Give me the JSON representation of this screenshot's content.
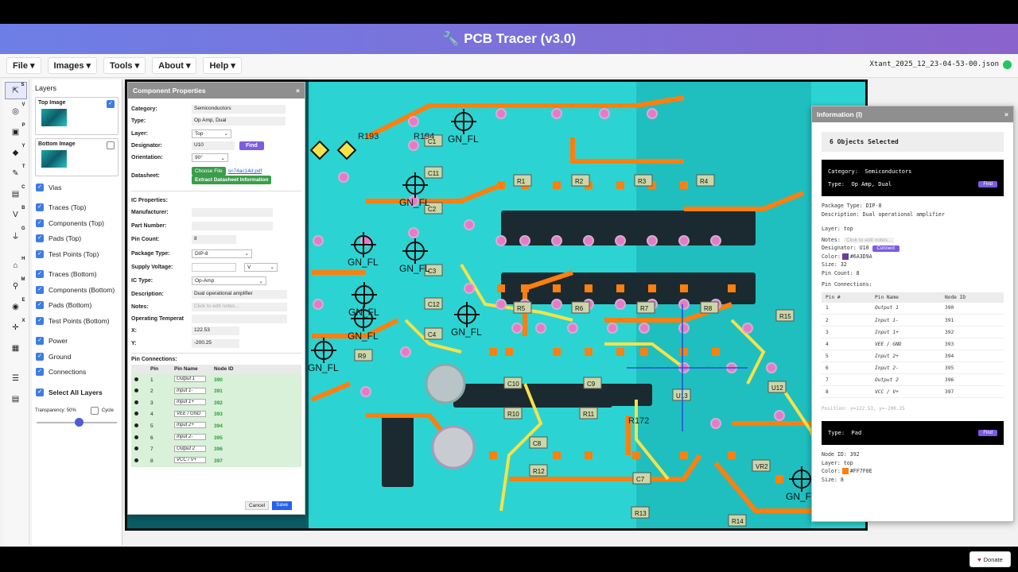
{
  "app": {
    "title": "PCB Tracer (v3.0)",
    "filename": "Xtant_2025_12_23-04-53-00.json",
    "donate": "Donate"
  },
  "menus": [
    "File ▾",
    "Images ▾",
    "Tools ▾",
    "About ▾",
    "Help ▾"
  ],
  "tools": [
    {
      "g": "⇱",
      "k": "S"
    },
    {
      "g": "◎",
      "k": "V",
      "n": "25"
    },
    {
      "g": "▣",
      "k": "P",
      "n": "30"
    },
    {
      "g": "◆",
      "k": "Y",
      "n": "25"
    },
    {
      "g": "✎",
      "k": "T",
      "n": "30"
    },
    {
      "g": "▤",
      "k": "C",
      "n": "1"
    },
    {
      "g": "V",
      "k": "B",
      "n": "25"
    },
    {
      "g": "⏚",
      "k": "G",
      "n": "25"
    },
    {
      "g": "⌂",
      "k": "H"
    },
    {
      "g": "⚲",
      "k": "M"
    },
    {
      "g": "◉",
      "k": "E"
    },
    {
      "g": "✛",
      "k": "X"
    },
    {
      "g": "▦",
      "k": ""
    },
    {
      "g": "☰",
      "k": ""
    },
    {
      "g": "▤",
      "k": ""
    }
  ],
  "layers": {
    "title": "Layers",
    "top_image": "Top Image",
    "bottom_image": "Bottom Image",
    "group1": [
      "Vias"
    ],
    "group2": [
      "Traces (Top)",
      "Components (Top)",
      "Pads (Top)",
      "Test Points (Top)"
    ],
    "group3": [
      "Traces (Bottom)",
      "Components (Bottom)",
      "Pads (Bottom)",
      "Test Points (Bottom)"
    ],
    "group4": [
      "Power",
      "Ground",
      "Connections"
    ],
    "select_all": "Select All Layers",
    "transparency": "Transparency: 50%",
    "cycle": "Cycle",
    "transparency_value": 0.5
  },
  "comp": {
    "title": "Component Properties",
    "category_l": "Category:",
    "category": "Semiconductors",
    "type_l": "Type:",
    "type": "Op Amp, Dual",
    "layer_l": "Layer:",
    "layer": "Top",
    "designator_l": "Designator:",
    "designator": "U10",
    "find": "Find",
    "orientation_l": "Orientation:",
    "orientation": "90°",
    "datasheet_l": "Datasheet:",
    "choose_file": "Choose File",
    "datasheet_file": "sn74ac14d.pdf",
    "extract": "Extract Datasheet Information",
    "ic_props": "IC Properties:",
    "manufacturer_l": "Manufacturer:",
    "partnum_l": "Part Number:",
    "pincount_l": "Pin Count:",
    "pincount": "8",
    "package_l": "Package Type:",
    "package": "DIP-8",
    "supply_l": "Supply Voltage:",
    "supply_unit": "V",
    "ictype_l": "IC Type:",
    "ictype": "Op-Amp",
    "desc_l": "Description:",
    "desc": "Dual operational amplifier",
    "notes_l": "Notes:",
    "notes_ph": "Click to edit notes...",
    "optemp_l": "Operating Temperat",
    "x_l": "X:",
    "x": "122.53",
    "y_l": "Y:",
    "y": "-200.25",
    "pinconn": "Pin Connections:",
    "pin_headers": [
      "Pin",
      "Pin Name",
      "Node ID"
    ],
    "pins": [
      {
        "pin": "1",
        "name": "Output 1",
        "node": "390"
      },
      {
        "pin": "2",
        "name": "Input 1-",
        "node": "391"
      },
      {
        "pin": "3",
        "name": "Input 1+",
        "node": "392"
      },
      {
        "pin": "4",
        "name": "VEE / GND",
        "node": "393"
      },
      {
        "pin": "5",
        "name": "Input 2+",
        "node": "394"
      },
      {
        "pin": "6",
        "name": "Input 2-",
        "node": "395"
      },
      {
        "pin": "7",
        "name": "Output 2",
        "node": "396"
      },
      {
        "pin": "8",
        "name": "VCC / V+",
        "node": "397"
      }
    ],
    "cancel": "Cancel",
    "save": "Save"
  },
  "info": {
    "title": "Information (I)",
    "selected": "6 Objects Selected",
    "category_l": "Category:",
    "category": "Semiconductors",
    "type_l": "Type:",
    "type": "Op Amp, Dual",
    "find": "Find",
    "lines": [
      "Package Type: DIP-8",
      "Description: Dual operational amplifier"
    ],
    "layer": "Layer: top",
    "notes_l": "Notes:",
    "notes_ph": "Click to edit notes...",
    "designator": "Designator: U10",
    "connect": "Connect",
    "color_l": "Color:",
    "color": "#6A3D9A",
    "size": "Size: 32",
    "pincount": "Pin Count: 8",
    "pinconn": "Pin Connections:",
    "headers": [
      "Pin #",
      "Pin Name",
      "Node ID"
    ],
    "pins": [
      {
        "pin": "1",
        "name": "Output 1",
        "node": "390"
      },
      {
        "pin": "2",
        "name": "Input 1-",
        "node": "391"
      },
      {
        "pin": "3",
        "name": "Input 1+",
        "node": "392"
      },
      {
        "pin": "4",
        "name": "VEE / GND",
        "node": "393"
      },
      {
        "pin": "5",
        "name": "Input 2+",
        "node": "394"
      },
      {
        "pin": "6",
        "name": "Input 2-",
        "node": "395"
      },
      {
        "pin": "7",
        "name": "Output 2",
        "node": "396"
      },
      {
        "pin": "8",
        "name": "VCC / V+",
        "node": "397"
      }
    ],
    "position": "Position: x=122.53, y=-200.25",
    "pad_type_l": "Type:",
    "pad_type": "Pad",
    "pad_lines": [
      "Node ID: 392",
      "Layer: top"
    ],
    "pad_color_l": "Color:",
    "pad_color": "#FF7F0E",
    "pad_size": "Size: 8"
  },
  "pcb_labels": [
    "C1",
    "C11",
    "C2",
    "C3",
    "C12",
    "C4",
    "C10",
    "C9",
    "C8",
    "C7",
    "R193",
    "R194",
    "R1",
    "R2",
    "R3",
    "R4",
    "R5",
    "R6",
    "R7",
    "R8",
    "R9",
    "R10",
    "R11",
    "R12",
    "R13",
    "R14",
    "R15",
    "R172",
    "R173",
    "R16",
    "U13",
    "U12",
    "VR2",
    "GN_FL",
    "GN_FL",
    "GN_FL",
    "GN_FL",
    "GN_FL",
    "GN_FL",
    "GN_FL"
  ]
}
